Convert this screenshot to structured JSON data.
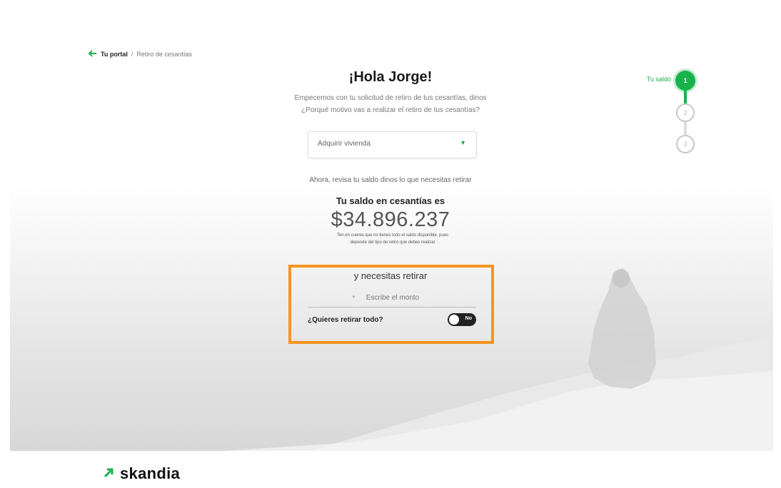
{
  "breadcrumb": {
    "home_label": "Tu portal",
    "separator": "/",
    "current_label": "Retiro de cesantías"
  },
  "main": {
    "greeting": "¡Hola Jorge!",
    "intro_line1": "Empecemos con tu solicitud de retiro de tus cesantías, dinos",
    "intro_line2": "¿Porqué motivo vas a realizar el retiro de tus cesantías?",
    "reason_select": {
      "value": "Adquirir vivienda"
    },
    "review_text": "Ahora, revisa tu saldo dinos lo que necesitas retirar",
    "balance_label": "Tu saldo en cesantías es",
    "balance_amount": "$34.896.237",
    "balance_note": "Ten en cuenta que no tienes todo el saldo disponible, pues depende del tipo de retiro que debes realizar"
  },
  "withdraw": {
    "title": "y necesitas retirar",
    "amount_placeholder": "Escribe el monto",
    "withdraw_all_label": "¿Quieres retirar todo?",
    "toggle_state_text": "No"
  },
  "stepper": {
    "active_label": "Tu saldo",
    "steps": [
      "1",
      "2",
      "3"
    ]
  },
  "footer": {
    "brand": "skandia"
  },
  "colors": {
    "accent": "#19b24b",
    "highlight": "#f7941d",
    "toggle": "#222222"
  }
}
